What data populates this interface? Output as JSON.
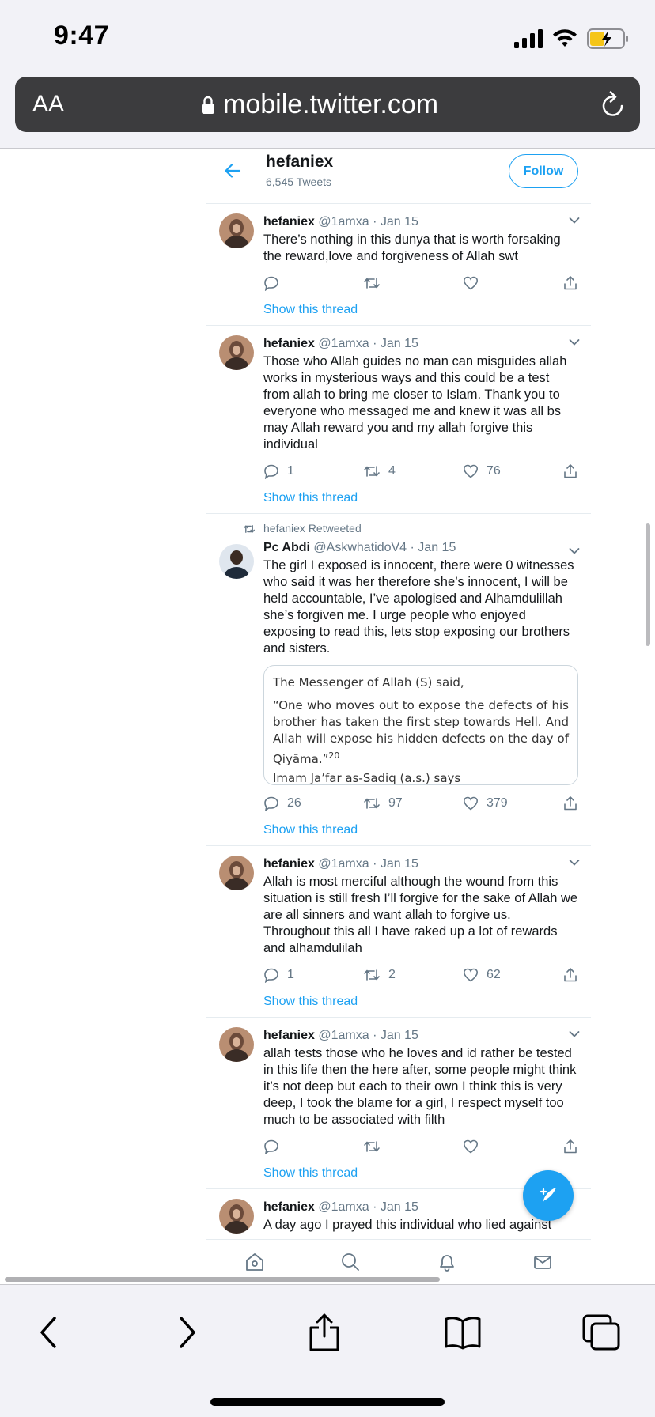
{
  "status_bar": {
    "time": "9:47"
  },
  "safari": {
    "text_size_button": "AA",
    "url": "mobile.twitter.com"
  },
  "profile": {
    "name": "hefaniex",
    "tweet_count": "6,545 Tweets",
    "follow_label": "Follow"
  },
  "tweets": [
    {
      "name": "hefaniex",
      "handle": "@1amxa",
      "date": "Jan 15",
      "text": "There’s nothing in this dunya that is worth forsaking the reward,love and forgiveness of Allah swt",
      "replies": "",
      "retweets": "",
      "likes": "",
      "thread_label": "Show this thread"
    },
    {
      "name": "hefaniex",
      "handle": "@1amxa",
      "date": "Jan 15",
      "text": "Those who Allah guides no man can misguides allah works in mysterious ways and this could be a test from allah to bring me closer to Islam. Thank you to everyone who messaged me and knew it was all bs may Allah reward you and my allah forgive this individual",
      "replies": "1",
      "retweets": "4",
      "likes": "76",
      "thread_label": "Show this thread"
    },
    {
      "retweeted_by": "hefaniex Retweeted",
      "name": "Pc Abdi",
      "handle": "@AskwhatidoV4",
      "date": "Jan 15",
      "text": "The girl I exposed is innocent, there were 0 witnesses who said it was her therefore she’s innocent, I will be held accountable, I’ve apologised and Alhamdulillah she’s forgiven me. I urge people who enjoyed exposing to read this, lets stop exposing our brothers and sisters.",
      "quote": {
        "title": "The Messenger of Allah (S) said,",
        "body": "“One who moves out to expose the defects of his brother has taken the first step towards Hell. And Allah will expose his hidden defects on the day of Qiyāma.”",
        "footnote": "20",
        "cut_line": "Imam Ja’far as-Sadiq (a.s.) says"
      },
      "replies": "26",
      "retweets": "97",
      "likes": "379",
      "thread_label": "Show this thread"
    },
    {
      "name": "hefaniex",
      "handle": "@1amxa",
      "date": "Jan 15",
      "text": "Allah is most merciful although the wound from this situation is still fresh I’ll forgive for the sake of Allah we are all sinners and want allah to forgive us. Throughout this all I have raked up a lot of rewards and alhamdulilah",
      "replies": "1",
      "retweets": "2",
      "likes": "62",
      "thread_label": "Show this thread"
    },
    {
      "name": "hefaniex",
      "handle": "@1amxa",
      "date": "Jan 15",
      "text": "allah tests those who he loves and id rather be tested in this life then the here after, some people might think it’s not deep but each to their own I think this is very deep, I took the blame for a girl, I respect myself too much to be associated with filth",
      "replies": "",
      "retweets": "",
      "likes": "",
      "thread_label": "Show this thread"
    },
    {
      "name": "hefaniex",
      "handle": "@1amxa",
      "date": "Jan 15",
      "text": "A day ago I prayed this individual who lied against",
      "replies": "",
      "retweets": "",
      "likes": "",
      "thread_label": ""
    }
  ],
  "separator": "·",
  "colors": {
    "twitter_blue": "#1da1f2",
    "meta_gray": "#657786",
    "safari_bar": "#3c3c3e"
  },
  "icons": [
    "back-arrow-icon",
    "chevron-down-icon",
    "reply-icon",
    "retweet-icon",
    "like-icon",
    "share-icon",
    "compose-icon",
    "home-icon",
    "search-icon",
    "bell-icon",
    "mail-icon",
    "lock-icon",
    "reload-icon",
    "safari-back-icon",
    "safari-forward-icon",
    "safari-share-icon",
    "bookmarks-icon",
    "tabs-icon"
  ]
}
